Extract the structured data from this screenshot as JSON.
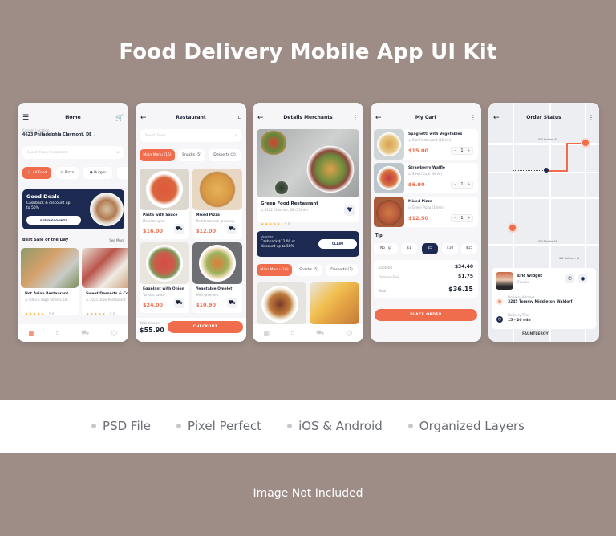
{
  "page": {
    "title": "Food Delivery Mobile App UI Kit",
    "features": [
      "PSD File",
      "Pixel Perfect",
      "iOS & Android",
      "Organized Layers"
    ],
    "footer_note": "Image Not Included"
  },
  "colors": {
    "background": "#9e8d87",
    "accent": "#ef6d4c",
    "navy": "#1c2a52",
    "star": "#f5b83c"
  },
  "home": {
    "title": "Home",
    "location_label": "Current Location",
    "location_value": "4623 Philadelphia Claymont, DE",
    "search_placeholder": "Search Food, Restaurant",
    "categories": [
      "All Food",
      "Pizza",
      "Burger"
    ],
    "promo": {
      "title": "Good Deals",
      "text": "Cashback & discount up to 50%",
      "button": "SEE DISCOUNTS"
    },
    "section_title": "Best Sale of the Day",
    "see_more": "See More",
    "restaurants": [
      {
        "name": "Hot Asian Restaurant",
        "address": "4083 E Sage Streets, DE",
        "rating": "5.0"
      },
      {
        "name": "Sweet Desserts & Co",
        "address": "7025 Olive Restaurant",
        "rating": "5.0"
      }
    ]
  },
  "restaurant": {
    "title": "Restaurant",
    "search_placeholder": "Search Food",
    "tabs": [
      "Main Menu (16)",
      "Snacks (5)",
      "Desserts (2)"
    ],
    "items": [
      {
        "name": "Pasta with Sauce",
        "desc": "Mexican spicy",
        "price": "$16.00"
      },
      {
        "name": "Mixed Pizza",
        "desc": "Mediterranean greenery",
        "price": "$12.00"
      },
      {
        "name": "Eggplant with Onion",
        "desc": "Tomato sauce",
        "price": "$24.00"
      },
      {
        "name": "Vegetable Omelet",
        "desc": "With greenery",
        "price": "$10.90"
      }
    ],
    "total_label": "Total Amount",
    "total_value": "$55.90",
    "checkout": "CHECKOUT"
  },
  "merchant": {
    "title": "Details Merchants",
    "name": "Green Food Restaurant",
    "address": "3122 Cheshire, DE (15min)",
    "rating": "5.0",
    "voucher": {
      "label": "Voucher",
      "text": "Cashback $12.00 or discount up to 50%",
      "button": "CLAIM"
    },
    "tabs": [
      "Main Menu (16)",
      "Snacks (5)",
      "Desserts (2)"
    ]
  },
  "cart": {
    "title": "My Cart",
    "items": [
      {
        "name": "Spaghetti with Vegetables",
        "shop": "Star Restaurant (15min)",
        "price": "$15.00",
        "qty": "1"
      },
      {
        "name": "Strawberry Waffle",
        "shop": "Sweet Cafe (8min)",
        "price": "$6.90",
        "qty": "1"
      },
      {
        "name": "Mixed Pizza",
        "shop": "Green Pizza (10min)",
        "price": "$12.50",
        "qty": "1"
      }
    ],
    "tip_label": "Tip",
    "tips": [
      "No Tip",
      "$1",
      "$5",
      "$10",
      "$15"
    ],
    "tip_selected": "$5",
    "subtotal_label": "Subtotal",
    "subtotal": "$34.40",
    "delivery_label": "Delivery Fee",
    "delivery": "$1.75",
    "total_label": "Total",
    "total": "$36.15",
    "place_order": "PLACE ORDER"
  },
  "order": {
    "title": "Order Status",
    "streets": [
      "SW Holden St",
      "SW Thistle St",
      "SW Sullivan St",
      "FAUNTLEROY"
    ],
    "courier_name": "Eric Widget",
    "courier_role": "Courier",
    "address_label": "Delivery Address",
    "address": "3245 Tommy Middleton Waldorf",
    "time_label": "Delivery Time",
    "time": "15 - 20 min"
  }
}
